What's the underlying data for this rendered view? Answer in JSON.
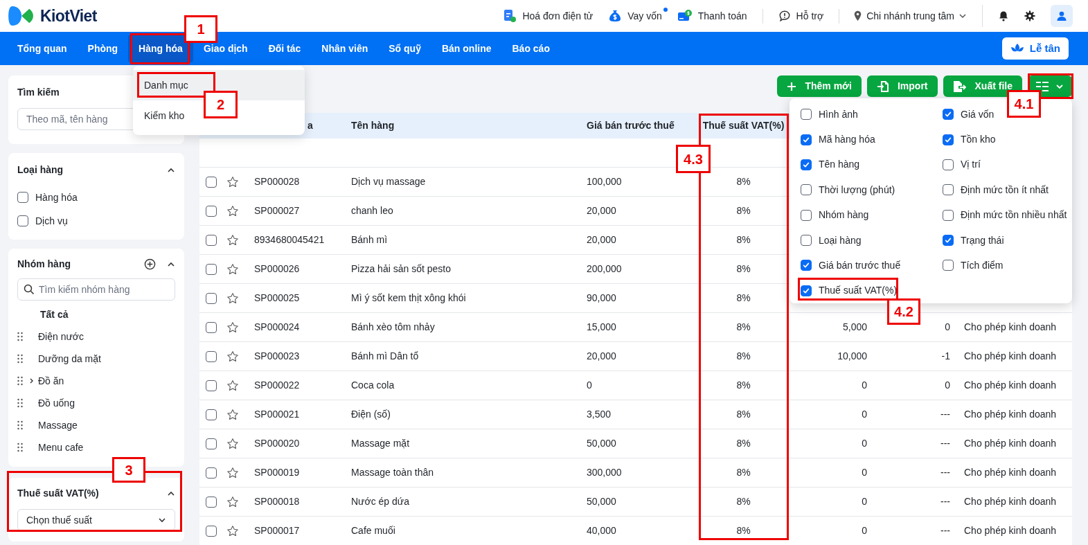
{
  "header": {
    "brand": "KiotViet",
    "links": [
      {
        "kind": "invoice",
        "label": "Hoá đơn điện tử"
      },
      {
        "kind": "loan",
        "label": "Vay vốn",
        "badge": true
      },
      {
        "kind": "payment",
        "label": "Thanh toán"
      },
      {
        "kind": "support",
        "label": "Hỗ trợ"
      }
    ],
    "branch": "Chi nhánh trung tâm"
  },
  "nav": {
    "tabs": [
      {
        "label": "Tổng quan",
        "selected": false
      },
      {
        "label": "Phòng",
        "selected": false
      },
      {
        "label": "Hàng hóa",
        "selected": true
      },
      {
        "label": "Giao dịch",
        "selected": false
      },
      {
        "label": "Đối tác",
        "selected": false
      },
      {
        "label": "Nhân viên",
        "selected": false
      },
      {
        "label": "Sổ quỹ",
        "selected": false
      },
      {
        "label": "Bán online",
        "selected": false
      },
      {
        "label": "Báo cáo",
        "selected": false
      }
    ],
    "reception_button": "Lễ tân"
  },
  "nav_menu": {
    "items": [
      {
        "label": "Danh mục",
        "selected": true
      },
      {
        "label": "Kiểm kho",
        "selected": false
      }
    ]
  },
  "sidebar": {
    "search": {
      "title": "Tìm kiếm",
      "placeholder": "Theo mã, tên hàng"
    },
    "product_type": {
      "title": "Loại hàng",
      "options": [
        {
          "label": "Hàng hóa",
          "checked": false
        },
        {
          "label": "Dịch vụ",
          "checked": false
        }
      ]
    },
    "groups": {
      "title": "Nhóm hàng",
      "placeholder": "Tìm kiếm nhóm hàng",
      "items": [
        {
          "label": "Tất cả",
          "selected": true,
          "kind": "all"
        },
        {
          "label": "Điện nước",
          "selected": false,
          "kind": "group"
        },
        {
          "label": "Dưỡng da mặt",
          "selected": false,
          "kind": "group"
        },
        {
          "label": "Đồ ăn",
          "selected": false,
          "kind": "group",
          "expanded": false
        },
        {
          "label": "Đồ uống",
          "selected": false,
          "kind": "group"
        },
        {
          "label": "Massage",
          "selected": false,
          "kind": "group"
        },
        {
          "label": "Menu cafe",
          "selected": false,
          "kind": "group"
        }
      ]
    },
    "vat": {
      "title": "Thuế suất VAT(%)",
      "value": "Chọn thuế suất"
    }
  },
  "toolbar": {
    "buttons": [
      {
        "kind": "add",
        "label": "Thêm mới"
      },
      {
        "kind": "import",
        "label": "Import"
      },
      {
        "kind": "export",
        "label": "Xuất file"
      },
      {
        "kind": "columns"
      }
    ]
  },
  "table": {
    "columns": [
      "a",
      "Tên hàng",
      "Giá bán trước thuế",
      "Thuế suất VAT(%)"
    ],
    "rows": [
      {
        "checked": false,
        "code": "SP000028",
        "name": "Dịch vụ massage",
        "price": "100,000",
        "vat": "8%"
      },
      {
        "checked": false,
        "code": "SP000027",
        "name": "chanh leo",
        "price": "20,000",
        "vat": "8%"
      },
      {
        "checked": false,
        "code": "8934680045421",
        "name": "Bánh mì",
        "price": "20,000",
        "vat": "8%"
      },
      {
        "checked": false,
        "code": "SP000026",
        "name": "Pizza hải sản sốt pesto",
        "price": "200,000",
        "vat": "8%"
      },
      {
        "checked": false,
        "code": "SP000025",
        "name": "Mì ý sốt kem thịt xông khói",
        "price": "90,000",
        "vat": "8%"
      },
      {
        "checked": false,
        "code": "SP000024",
        "name": "Bánh xèo tôm nhảy",
        "price": "15,000",
        "vat": "8%",
        "cost": "5,000",
        "stock": "0",
        "status": "Cho phép kinh doanh"
      },
      {
        "checked": false,
        "code": "SP000023",
        "name": "Bánh mì Dân tổ",
        "price": "20,000",
        "vat": "8%",
        "cost": "10,000",
        "stock": "-1",
        "status": "Cho phép kinh doanh"
      },
      {
        "checked": false,
        "code": "SP000022",
        "name": "Coca cola",
        "price": "0",
        "vat": "8%",
        "cost": "0",
        "stock": "0",
        "status": "Cho phép kinh doanh"
      },
      {
        "checked": false,
        "code": "SP000021",
        "name": "Điện (số)",
        "price": "3,500",
        "vat": "8%",
        "cost": "0",
        "stock": "---",
        "status": "Cho phép kinh doanh"
      },
      {
        "checked": false,
        "code": "SP000020",
        "name": "Massage mặt",
        "price": "50,000",
        "vat": "8%",
        "cost": "0",
        "stock": "---",
        "status": "Cho phép kinh doanh"
      },
      {
        "checked": false,
        "code": "SP000019",
        "name": "Massage toàn thân",
        "price": "300,000",
        "vat": "8%",
        "cost": "0",
        "stock": "---",
        "status": "Cho phép kinh doanh"
      },
      {
        "checked": false,
        "code": "SP000018",
        "name": "Nước ép dứa",
        "price": "50,000",
        "vat": "8%",
        "cost": "0",
        "stock": "---",
        "status": "Cho phép kinh doanh"
      },
      {
        "checked": false,
        "code": "SP000017",
        "name": "Cafe muối",
        "price": "40,000",
        "vat": "8%",
        "cost": "0",
        "stock": "---",
        "status": "Cho phép kinh doanh"
      }
    ]
  },
  "column_picker": {
    "options": [
      {
        "label": "Hình ảnh",
        "checked": false
      },
      {
        "label": "Mã hàng hóa",
        "checked": true
      },
      {
        "label": "Tên hàng",
        "checked": true
      },
      {
        "label": "Thời lượng (phút)",
        "checked": false
      },
      {
        "label": "Nhóm hàng",
        "checked": false
      },
      {
        "label": "Loại hàng",
        "checked": false
      },
      {
        "label": "Giá bán trước thuế",
        "checked": true
      },
      {
        "label": "Thuế suất VAT(%)",
        "checked": true
      },
      {
        "label": "Giá vốn",
        "checked": true
      },
      {
        "label": "Tồn kho",
        "checked": true
      },
      {
        "label": "Vị trí",
        "checked": false
      },
      {
        "label": "Định mức tồn ít nhất",
        "checked": false
      },
      {
        "label": "Định mức tồn nhiều nhất",
        "checked": false
      },
      {
        "label": "Trạng thái",
        "checked": true
      },
      {
        "label": "Tích điểm",
        "checked": false
      }
    ]
  },
  "annotations": [
    {
      "label": "1"
    },
    {
      "label": "2"
    },
    {
      "label": "3"
    },
    {
      "label": "4.1"
    },
    {
      "label": "4.2"
    },
    {
      "label": "4.3"
    }
  ]
}
